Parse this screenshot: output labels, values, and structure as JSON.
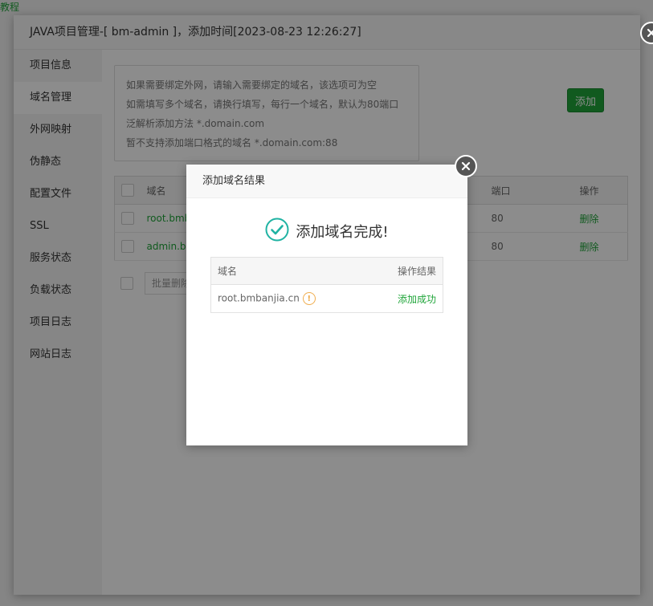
{
  "background": {
    "corner_link": "教程"
  },
  "main_dialog": {
    "title": "JAVA项目管理-[ bm-admin ]，添加时间[2023-08-23 12:26:27]",
    "sidebar": [
      {
        "label": "项目信息"
      },
      {
        "label": "域名管理"
      },
      {
        "label": "外网映射"
      },
      {
        "label": "伪静态"
      },
      {
        "label": "配置文件"
      },
      {
        "label": "SSL"
      },
      {
        "label": "服务状态"
      },
      {
        "label": "负载状态"
      },
      {
        "label": "项目日志"
      },
      {
        "label": "网站日志"
      }
    ],
    "active_index": 1,
    "tips": [
      "如果需要绑定外网，请输入需要绑定的域名，该选项可为空",
      "如需填写多个域名，请换行填写，每行一个域名，默认为80端口",
      "泛解析添加方法 *.domain.com",
      "暂不支持添加端口格式的域名 *.domain.com:88"
    ],
    "add_button": "添加",
    "table": {
      "headers": {
        "domain": "域名",
        "port": "端口",
        "action": "操作"
      },
      "rows": [
        {
          "domain": "root.bmb",
          "port": "80",
          "action": "删除"
        },
        {
          "domain": "admin.bi",
          "port": "80",
          "action": "删除"
        }
      ]
    },
    "batch_placeholder": "批量删除"
  },
  "result_modal": {
    "title": "添加域名结果",
    "message": "添加域名完成!",
    "headers": {
      "domain": "域名",
      "result": "操作结果"
    },
    "rows": [
      {
        "domain": "root.bmbanjia.cn",
        "result": "添加成功"
      }
    ]
  },
  "colors": {
    "accent": "#20a53a",
    "success_icon": "#20b3a3",
    "warning": "#f0ad4e"
  }
}
